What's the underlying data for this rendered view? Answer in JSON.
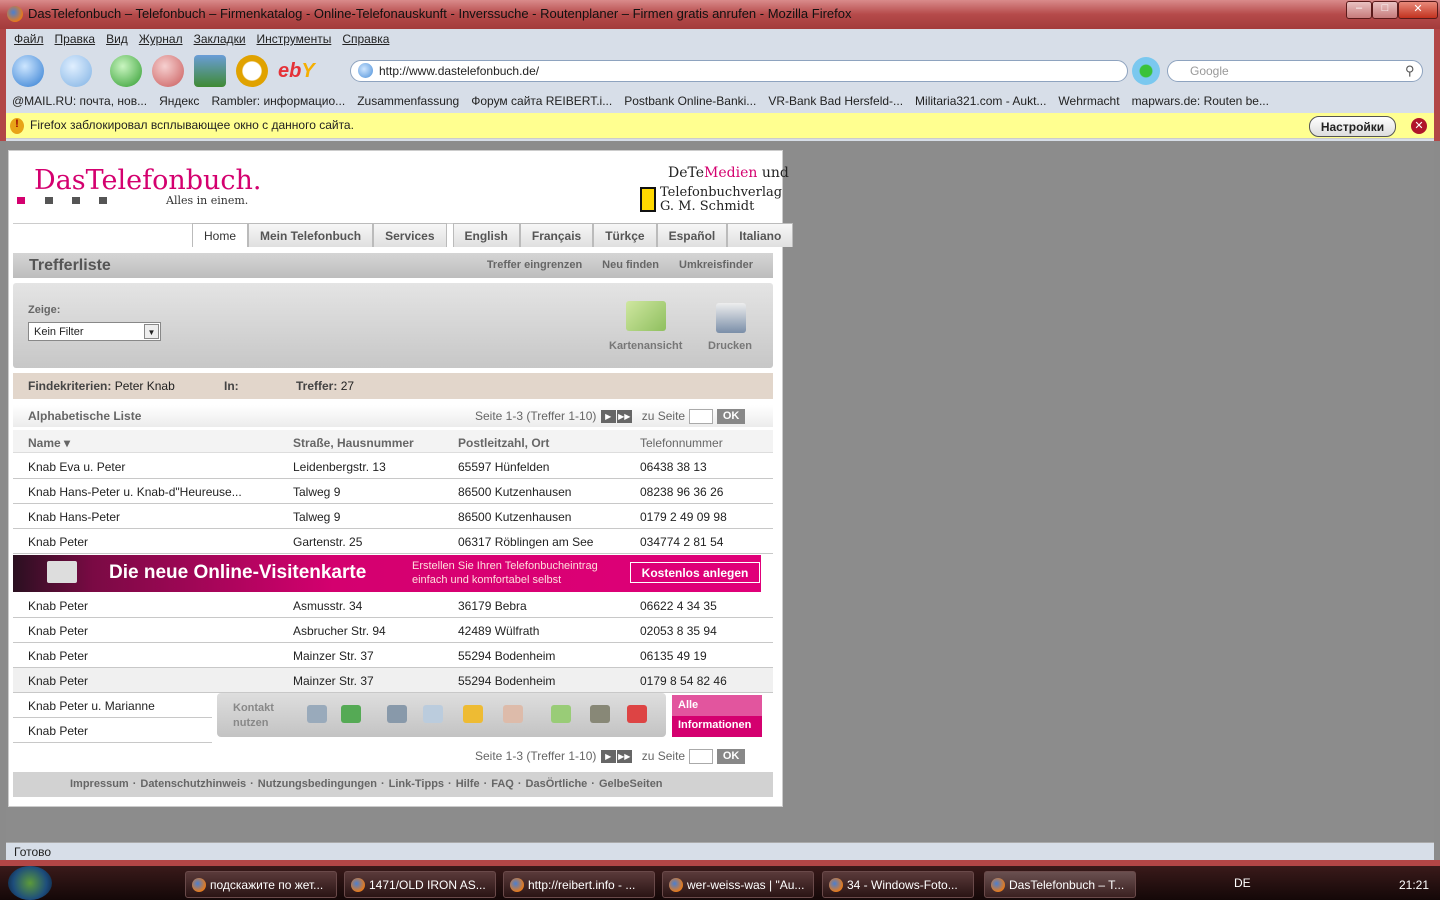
{
  "window": {
    "title": "DasTelefonbuch – Telefonbuch – Firmenkatalog - Online-Telefonauskunft - Inverssuche - Routenplaner – Firmen gratis anrufen - Mozilla Firefox",
    "minimize": "–",
    "maximize": "□",
    "close": "✕"
  },
  "menu": [
    "Файл",
    "Правка",
    "Вид",
    "Журнал",
    "Закладки",
    "Инструменты",
    "Справка"
  ],
  "toolbar": {
    "url": "http://www.dastelefonbuch.de/",
    "search_placeholder": "Google"
  },
  "bookmarks": [
    "@MAIL.RU: почта, нов...",
    "Яндекс",
    "Rambler: информацио...",
    "Zusammenfassung",
    "Форум сайта REIBERT.i...",
    "Postbank Online-Banki...",
    "VR-Bank Bad Hersfeld-...",
    "Militaria321.com - Aukt...",
    "Wehrmacht",
    "mapwars.de: Routen be..."
  ],
  "notification": {
    "text": "Firefox заблокировал всплывающее окно с данного сайта.",
    "button": "Настройки"
  },
  "site": {
    "logo": "DasTelefonbuch.",
    "slogan": "Alles in einem.",
    "publisher1_a": "DeTe",
    "publisher1_b": "Medien",
    "publisher1_c": " und",
    "publisher2": "Telefonbuchverlag",
    "publisher3": "G. M. Schmidt",
    "tabs": [
      "Home",
      "Mein Telefonbuch",
      "Services",
      "English",
      "Français",
      "Türkçe",
      "Español",
      "Italiano"
    ],
    "section_title": "Trefferliste",
    "section_links": [
      "Treffer eingrenzen",
      "Neu finden",
      "Umkreisfinder"
    ],
    "filter_label": "Zeige:",
    "filter_value": "Kein Filter",
    "map_view": "Kartenansicht",
    "print": "Drucken",
    "criteria_label": "Findekriterien:",
    "criteria_value": "Peter Knab",
    "in_label": "In:",
    "hits_label": "Treffer:",
    "hits_value": "27",
    "list_title": "Alphabetische Liste",
    "pager": "Seite 1-3 (Treffer 1-10)",
    "goto": "zu Seite",
    "ok": "OK",
    "columns": [
      "Name ▾",
      "Straße, Hausnummer",
      "Postleitzahl, Ort",
      "Telefonnummer"
    ],
    "rows": [
      [
        "Knab Eva u. Peter",
        "Leidenbergstr. 13",
        "65597 Hünfelden",
        "06438 38 13"
      ],
      [
        "Knab Hans-Peter u. Knab-d\"Heureuse...",
        "Talweg 9",
        "86500 Kutzenhausen",
        "08238 96 36 26"
      ],
      [
        "Knab Hans-Peter",
        "Talweg 9",
        "86500 Kutzenhausen",
        "0179 2 49 09 98"
      ],
      [
        "Knab Peter",
        "Gartenstr. 25",
        "06317 Röblingen am See",
        "034774 2 81 54"
      ],
      [
        "Knab Peter",
        "Asmusstr. 34",
        "36179 Bebra",
        "06622 4 34 35"
      ],
      [
        "Knab Peter",
        "Asbrucher Str. 94",
        "42489 Wülfrath",
        "02053 8 35 94"
      ],
      [
        "Knab Peter",
        "Mainzer Str. 37",
        "55294 Bodenheim",
        "06135 49 19"
      ],
      [
        "Knab Peter",
        "Mainzer Str. 37",
        "55294 Bodenheim",
        "0179 8 54 82 46"
      ],
      [
        "Knab Peter u. Marianne"
      ],
      [
        "Knab Peter"
      ]
    ],
    "banner": {
      "title": "Die neue Online-Visitenkarte",
      "line1": "Erstellen Sie Ihren Telefonbucheintrag",
      "line2": "einfach und komfortabel selbst",
      "button": "Kostenlos anlegen"
    },
    "action": {
      "label1": "Kontakt",
      "label2": "nutzen",
      "all1": "Alle",
      "all2": "Informationen"
    },
    "footer": [
      "Impressum",
      "Datenschutzhinweis",
      "Nutzungsbedingungen",
      "Link-Tipps",
      "Hilfe",
      "FAQ",
      "DasÖrtliche",
      "GelbeSeiten"
    ]
  },
  "status": "Готово",
  "taskbar": {
    "tasks": [
      "подскажите по жет...",
      "1471/OLD IRON AS...",
      "http://reibert.info - ...",
      "wer-weiss-was | \"Au...",
      "34 - Windows-Foto...",
      "DasTelefonbuch – T..."
    ],
    "lang": "DE",
    "time": "21:21"
  }
}
